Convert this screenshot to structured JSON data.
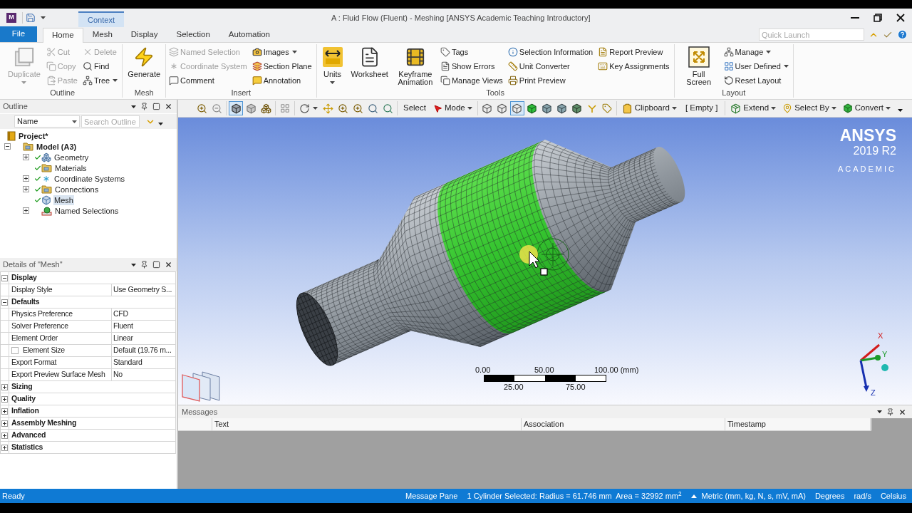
{
  "title_bar": {
    "app_letter": "M",
    "context_tab": "Context",
    "title": "A : Fluid Flow (Fluent) - Meshing [ANSYS Academic Teaching Introductory]"
  },
  "ribbon_tabs": [
    {
      "label": "File",
      "kind": "file",
      "selected": false
    },
    {
      "label": "Home",
      "kind": "tab",
      "selected": true
    },
    {
      "label": "Mesh",
      "kind": "tab",
      "selected": false
    },
    {
      "label": "Display",
      "kind": "tab",
      "selected": false
    },
    {
      "label": "Selection",
      "kind": "tab",
      "selected": false
    },
    {
      "label": "Automation",
      "kind": "tab",
      "selected": false
    }
  ],
  "quick_launch": {
    "placeholder": "Quick Launch"
  },
  "ribbon_groups": [
    {
      "label": "Outline",
      "columns": [
        {
          "kind": "large",
          "label": "Duplicate",
          "disabled": true,
          "dropdown": true
        },
        {
          "kind": "stack",
          "items": [
            {
              "label": "Cut",
              "disabled": true,
              "dropdown": false
            },
            {
              "label": "Copy",
              "disabled": true,
              "dropdown": false
            },
            {
              "label": "Paste",
              "disabled": true,
              "dropdown": false
            }
          ]
        },
        {
          "kind": "stack",
          "items": [
            {
              "label": "Delete",
              "disabled": true,
              "dropdown": false
            },
            {
              "label": "Find",
              "disabled": false,
              "dropdown": false
            },
            {
              "label": "Tree",
              "disabled": false,
              "dropdown": true
            }
          ]
        }
      ]
    },
    {
      "label": "Mesh",
      "columns": [
        {
          "kind": "large",
          "label": "Generate",
          "disabled": false,
          "dropdown": false
        }
      ]
    },
    {
      "label": "Insert",
      "columns": [
        {
          "kind": "stack",
          "items": [
            {
              "label": "Named Selection",
              "disabled": true,
              "dropdown": false
            },
            {
              "label": "Coordinate System",
              "disabled": true,
              "dropdown": false
            },
            {
              "label": "Comment",
              "disabled": false,
              "dropdown": false
            }
          ]
        },
        {
          "kind": "stack",
          "items": [
            {
              "label": "Images",
              "disabled": false,
              "dropdown": true
            },
            {
              "label": "Section Plane",
              "disabled": false,
              "dropdown": false
            },
            {
              "label": "Annotation",
              "disabled": false,
              "dropdown": false
            }
          ]
        }
      ]
    },
    {
      "label": "Tools",
      "columns": [
        {
          "kind": "large",
          "label": "Units",
          "disabled": false,
          "dropdown": true
        },
        {
          "kind": "large",
          "label": "Worksheet",
          "disabled": false,
          "dropdown": false
        },
        {
          "kind": "large",
          "label": "Keyframe Animation",
          "disabled": false,
          "dropdown": false
        },
        {
          "kind": "stack",
          "items": [
            {
              "label": "Tags",
              "disabled": false,
              "dropdown": false
            },
            {
              "label": "Show Errors",
              "disabled": false,
              "dropdown": false
            },
            {
              "label": "Manage Views",
              "disabled": false,
              "dropdown": false
            }
          ]
        },
        {
          "kind": "stack",
          "items": [
            {
              "label": "Selection Information",
              "disabled": false,
              "dropdown": false
            },
            {
              "label": "Unit Converter",
              "disabled": false,
              "dropdown": false
            },
            {
              "label": "Print Preview",
              "disabled": false,
              "dropdown": false
            }
          ]
        },
        {
          "kind": "stack",
          "items": [
            {
              "label": "Report Preview",
              "disabled": false,
              "dropdown": false
            },
            {
              "label": "Key Assignments",
              "disabled": false,
              "dropdown": false
            }
          ]
        }
      ]
    },
    {
      "label": "Layout",
      "columns": [
        {
          "kind": "large",
          "label": "Full Screen",
          "disabled": false,
          "dropdown": false
        },
        {
          "kind": "stack",
          "items": [
            {
              "label": "Manage",
              "disabled": false,
              "dropdown": true
            },
            {
              "label": "User Defined",
              "disabled": false,
              "dropdown": true
            },
            {
              "label": "Reset Layout",
              "disabled": false,
              "dropdown": false
            }
          ]
        }
      ]
    }
  ],
  "view_toolbar": [
    [
      {
        "kind": "icon",
        "selected": false
      },
      {
        "kind": "icon",
        "selected": false
      }
    ],
    [
      {
        "kind": "icon",
        "selected": true
      },
      {
        "kind": "icon",
        "selected": false
      },
      {
        "kind": "icon",
        "selected": false
      }
    ],
    [
      {
        "kind": "icon",
        "selected": false
      }
    ],
    [
      {
        "kind": "icon_menu",
        "selected": false
      },
      {
        "kind": "icon",
        "selected": false
      },
      {
        "kind": "icon",
        "selected": false
      },
      {
        "kind": "icon",
        "selected": false
      },
      {
        "kind": "icon",
        "selected": false
      },
      {
        "kind": "icon",
        "selected": false
      }
    ],
    [
      {
        "kind": "text",
        "label": "Select",
        "selected": false
      },
      {
        "kind": "menu",
        "label": "Mode",
        "selected": false
      }
    ],
    [
      {
        "kind": "icon",
        "selected": false
      },
      {
        "kind": "icon",
        "selected": false
      },
      {
        "kind": "icon",
        "selected": true
      },
      {
        "kind": "icon",
        "selected": false
      },
      {
        "kind": "icon",
        "selected": false
      },
      {
        "kind": "icon",
        "selected": false
      },
      {
        "kind": "icon",
        "selected": false
      },
      {
        "kind": "icon",
        "selected": false
      },
      {
        "kind": "icon",
        "selected": false
      }
    ],
    [
      {
        "kind": "menu",
        "label": "Clipboard",
        "selected": false
      },
      {
        "kind": "label",
        "label": "[ Empty ]",
        "selected": false
      }
    ],
    [
      {
        "kind": "menu",
        "label": "Extend",
        "selected": false
      },
      {
        "kind": "menu",
        "label": "Select By",
        "selected": false
      },
      {
        "kind": "menu",
        "label": "Convert",
        "selected": false
      },
      {
        "kind": "overflow",
        "selected": false
      }
    ]
  ],
  "outline": {
    "title": "Outline",
    "filter": "Name",
    "search": {
      "placeholder": "Search Outline"
    },
    "tree": [
      {
        "label": "Project*",
        "checked": false,
        "selected": false,
        "children": [
          {
            "label": "Model (A3)",
            "expanded": true,
            "checked": false,
            "selected": false,
            "children": [
              {
                "label": "Geometry",
                "expanded": false,
                "checked": true,
                "selected": false
              },
              {
                "label": "Materials",
                "checked": true,
                "selected": false
              },
              {
                "label": "Coordinate Systems",
                "expanded": false,
                "checked": true,
                "selected": false
              },
              {
                "label": "Connections",
                "expanded": false,
                "checked": true,
                "selected": false
              },
              {
                "label": "Mesh",
                "checked": true,
                "selected": true
              },
              {
                "label": "Named Selections",
                "expanded": false,
                "checked": false,
                "selected": false
              }
            ]
          }
        ]
      }
    ]
  },
  "details": {
    "title": "Details of \"Mesh\"",
    "sections": [
      {
        "label": "Display",
        "expanded": true,
        "rows": [
          {
            "kind": "plain",
            "label": "Display Style",
            "value": "Use Geometry S..."
          }
        ]
      },
      {
        "label": "Defaults",
        "expanded": true,
        "rows": [
          {
            "kind": "plain",
            "label": "Physics Preference",
            "value": "CFD"
          },
          {
            "kind": "plain",
            "label": "Solver Preference",
            "value": "Fluent"
          },
          {
            "kind": "plain",
            "label": "Element Order",
            "value": "Linear"
          },
          {
            "kind": "checkbox",
            "checked": false,
            "label": "Element Size",
            "value": "Default (19.76 m..."
          },
          {
            "kind": "plain",
            "label": "Export Format",
            "value": "Standard"
          },
          {
            "kind": "plain",
            "label": "Export Preview Surface Mesh",
            "value": "No"
          }
        ]
      },
      {
        "label": "Sizing",
        "expanded": false
      },
      {
        "label": "Quality",
        "expanded": false
      },
      {
        "label": "Inflation",
        "expanded": false
      },
      {
        "label": "Assembly Meshing",
        "expanded": false
      },
      {
        "label": "Advanced",
        "expanded": false
      },
      {
        "label": "Statistics",
        "expanded": false
      }
    ]
  },
  "viewport": {
    "logo": {
      "brand": "ANSYS",
      "version": "2019 R2",
      "edition": "ACADEMIC"
    },
    "scale_bar": {
      "top_labels": [
        "0.00",
        "50.00",
        "100.00 (mm)"
      ],
      "bottom_labels": [
        "25.00",
        "75.00"
      ]
    },
    "triad": {
      "x": "X",
      "y": "Y",
      "z": "Z"
    }
  },
  "messages": {
    "title": "Messages",
    "columns": [
      "Text",
      "Association",
      "Timestamp"
    ]
  },
  "status_bar": {
    "left": "Ready",
    "items": [
      {
        "kind": "button",
        "label": "Message Pane"
      },
      {
        "kind": "text",
        "label": "1 Cylinder Selected: Radius = 61.746 mm  Area = 32992 mm$^{2}$"
      },
      {
        "kind": "menu",
        "label": "Metric (mm, kg, N, s, mV, mA)"
      },
      {
        "kind": "button",
        "label": "Degrees"
      },
      {
        "kind": "button",
        "label": "rad/s"
      },
      {
        "kind": "button",
        "label": "Celsius"
      }
    ]
  }
}
